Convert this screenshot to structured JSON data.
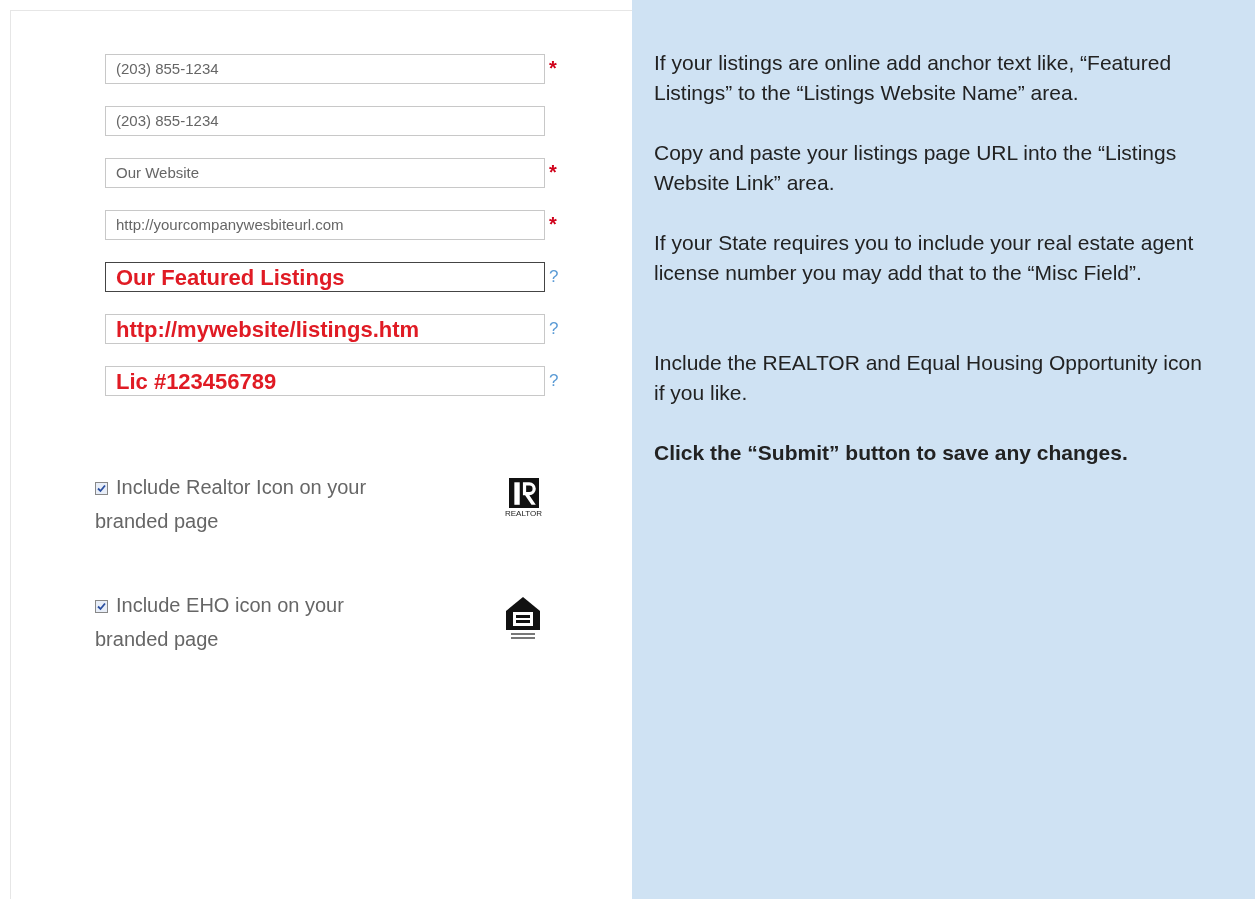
{
  "fields": [
    {
      "value": "(203) 855-1234",
      "kind": "required",
      "marker": "*",
      "overlay": false,
      "focused": false
    },
    {
      "value": "(203) 855-1234",
      "kind": "plain",
      "overlay": false,
      "focused": false
    },
    {
      "value": "Our Website",
      "kind": "required",
      "marker": "*",
      "overlay": false,
      "focused": false
    },
    {
      "value": "http://yourcompanywesbiteurl.com",
      "kind": "required",
      "marker": "*",
      "overlay": false,
      "focused": false
    },
    {
      "value": "Our Featured Listings",
      "kind": "help",
      "marker": "?",
      "overlay": true,
      "focused": true
    },
    {
      "value": "http://mywebsite/listings.htm",
      "kind": "help",
      "marker": "?",
      "overlay": true,
      "focused": false
    },
    {
      "value": "Lic #123456789",
      "kind": "help",
      "marker": "?",
      "overlay": true,
      "focused": false
    }
  ],
  "options": [
    {
      "label": "Include Realtor Icon on your branded page",
      "checked": true,
      "kind": "realtor",
      "logo_text": "REALTOR"
    },
    {
      "label": "Include EHO icon on your branded page",
      "checked": true,
      "kind": "eho"
    }
  ],
  "instructions": [
    {
      "text": "If your listings are online add anchor text like, “Featured Listings” to the “Listings Website Name” area.",
      "bold": false
    },
    {
      "text": "Copy and paste your listings page URL into the “Listings Website Link” area.",
      "bold": false
    },
    {
      "text": "If your State requires you to include your real estate agent license number you may add that to the “Misc Field”.",
      "bold": false
    },
    {
      "text": "Include the REALTOR and Equal Housing Opportunity icon if you like.",
      "bold": false
    },
    {
      "text": "Click the “Submit” button to save any changes.",
      "bold": true
    }
  ]
}
